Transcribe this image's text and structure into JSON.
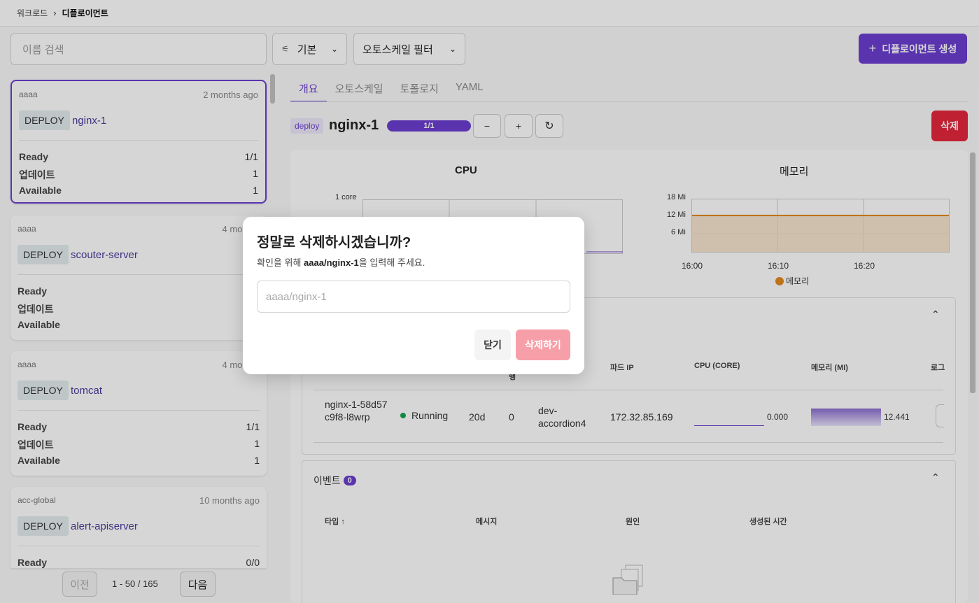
{
  "breadcrumb": {
    "parent": "워크로드",
    "current": "디플로이먼트"
  },
  "toolbar": {
    "search_placeholder": "이름 검색",
    "view_select": "기본",
    "autoscale_filter": "오토스케일 필터",
    "create_button": "디플로이먼트 생성"
  },
  "list": {
    "items": [
      {
        "namespace": "aaaa",
        "age": "2 months ago",
        "kind": "DEPLOY",
        "name": "nginx-1",
        "ready_label": "Ready",
        "ready": "1/1",
        "updated_label": "업데이트",
        "updated": "1",
        "available_label": "Available",
        "available": "1"
      },
      {
        "namespace": "aaaa",
        "age": "4 months",
        "kind": "DEPLOY",
        "name": "scouter-server",
        "ready_label": "Ready",
        "updated_label": "업데이트",
        "available_label": "Available"
      },
      {
        "namespace": "aaaa",
        "age": "4 months",
        "kind": "DEPLOY",
        "name": "tomcat",
        "ready_label": "Ready",
        "ready": "1/1",
        "updated_label": "업데이트",
        "updated": "1",
        "available_label": "Available",
        "available": "1"
      },
      {
        "namespace": "acc-global",
        "age": "10 months ago",
        "kind": "DEPLOY",
        "name": "alert-apiserver",
        "ready_label": "Ready",
        "ready": "0/0"
      }
    ],
    "pager": {
      "prev": "이전",
      "range": "1 - 50 / 165",
      "next": "다음"
    }
  },
  "detail": {
    "tabs": [
      "개요",
      "오토스케일",
      "토폴로지",
      "YAML"
    ],
    "badge": "deploy",
    "name": "nginx-1",
    "replicas_label": "1/1",
    "replicas_fraction": 1.0,
    "minus": "−",
    "plus": "+",
    "refresh_icon": "refresh-icon",
    "delete_button": "삭제"
  },
  "charts": {
    "cpu": {
      "title": "CPU",
      "ytick": "1 core"
    },
    "memory": {
      "title": "메모리",
      "yticks": [
        "18 Mi",
        "12 Mi",
        "6 Mi"
      ],
      "xticks": [
        "16:00",
        "16:10",
        "16:20"
      ],
      "legend": "메모리",
      "color": "#e08a1e"
    }
  },
  "pods": {
    "headers": {
      "frag": "행",
      "pod_ip": "파드 IP",
      "cpu": "CPU (CORE)",
      "memory": "메모리 (MI)",
      "log": "로그"
    },
    "row": {
      "name": "nginx-1-58d57c9f8-l8wrp",
      "status": "Running",
      "age": "20d",
      "restarts": "0",
      "node": "dev-accordion4",
      "ip": "172.32.85.169",
      "cpu": "0.000",
      "memory": "12.441"
    }
  },
  "events": {
    "title": "이벤트",
    "count": "0",
    "headers": {
      "type": "타입",
      "message": "메시지",
      "reason": "원인",
      "created": "생성된 시간"
    }
  },
  "modal": {
    "title": "정말로 삭제하시겠습니까?",
    "desc_prefix": "확인을 위해 ",
    "desc_target": "aaaa/nginx-1",
    "desc_suffix": "을 입력해 주세요.",
    "placeholder": "aaaa/nginx-1",
    "close_button": "닫기",
    "confirm_button": "삭제하기"
  },
  "colors": {
    "accent": "#6c3fd1",
    "danger": "#e5283c",
    "running": "#16a34a"
  }
}
